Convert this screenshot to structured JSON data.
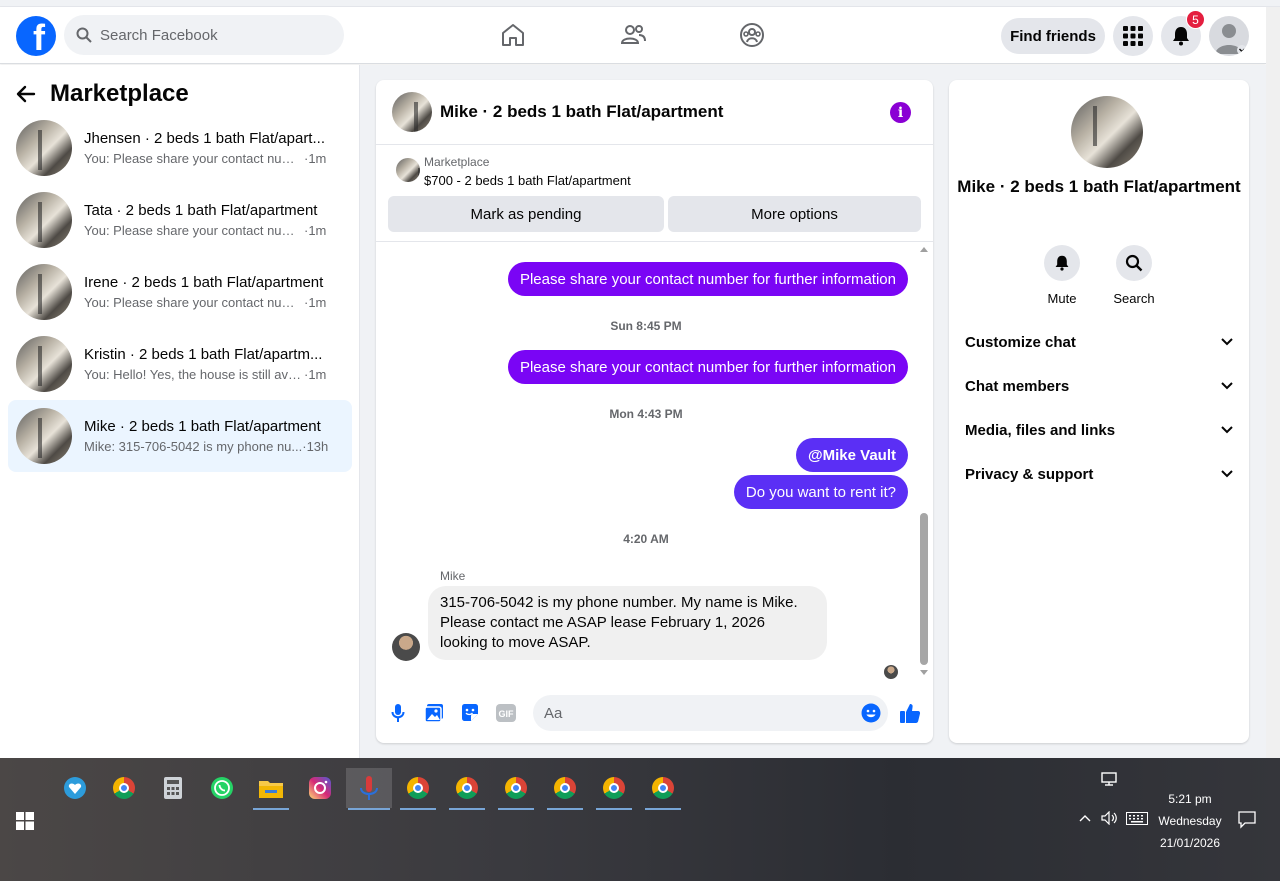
{
  "topbar": {
    "search_placeholder": "Search Facebook",
    "find_friends": "Find friends",
    "notification_count": "5"
  },
  "sidebar": {
    "title": "Marketplace",
    "conversations": [
      {
        "name": "Jhensen · 2 beds 1 bath Flat/apart...",
        "preview": "You: Please share your contact numb...",
        "time": "·1m"
      },
      {
        "name": "Tata · 2 beds 1 bath Flat/apartment",
        "preview": "You: Please share your contact numb...",
        "time": "·1m"
      },
      {
        "name": "Irene · 2 beds 1 bath Flat/apartment",
        "preview": "You: Please share your contact numb...",
        "time": "·1m"
      },
      {
        "name": "Kristin · 2 beds 1 bath Flat/apartm...",
        "preview": "You: Hello! Yes, the house is still avail...",
        "time": "·1m"
      },
      {
        "name": "Mike · 2 beds 1 bath Flat/apartment",
        "preview": "Mike: 315-706-5042 is my phone nu...",
        "time": "·13h"
      }
    ]
  },
  "chat": {
    "title": "Mike · 2 beds 1 bath Flat/apartment",
    "listing_source": "Marketplace",
    "listing_price": "$700 - 2 beds 1 bath Flat/apartment",
    "mark_pending": "Mark as pending",
    "more_options": "More options",
    "messages": {
      "out1": "Please share your contact number for further information",
      "ts1": "Sun 8:45 PM",
      "out2": "Please share your contact number for further information",
      "ts2": "Mon 4:43 PM",
      "out3": "@Mike Vault",
      "out4": "Do you want to rent it?",
      "ts3": "4:20 AM",
      "sender": "Mike",
      "in1": "315-706-5042 is my phone number. My name is Mike. Please contact me ASAP lease February 1, 2026 looking to move ASAP."
    },
    "composer_placeholder": "Aa"
  },
  "details": {
    "name": "Mike · 2 beds 1 bath Flat/apartment",
    "mute": "Mute",
    "search": "Search",
    "sections": [
      "Customize chat",
      "Chat members",
      "Media, files and links",
      "Privacy & support"
    ]
  },
  "taskbar": {
    "time": "5:21 pm",
    "day": "Wednesday",
    "date": "21/01/2026"
  },
  "colors": {
    "fb_blue": "#0866ff",
    "outgoing_bubble": "#7a05f5",
    "outgoing_bubble_alt": "#5b2ff5",
    "info_purple": "#8a00d4",
    "active_conversation_bg": "#ebf5ff"
  }
}
